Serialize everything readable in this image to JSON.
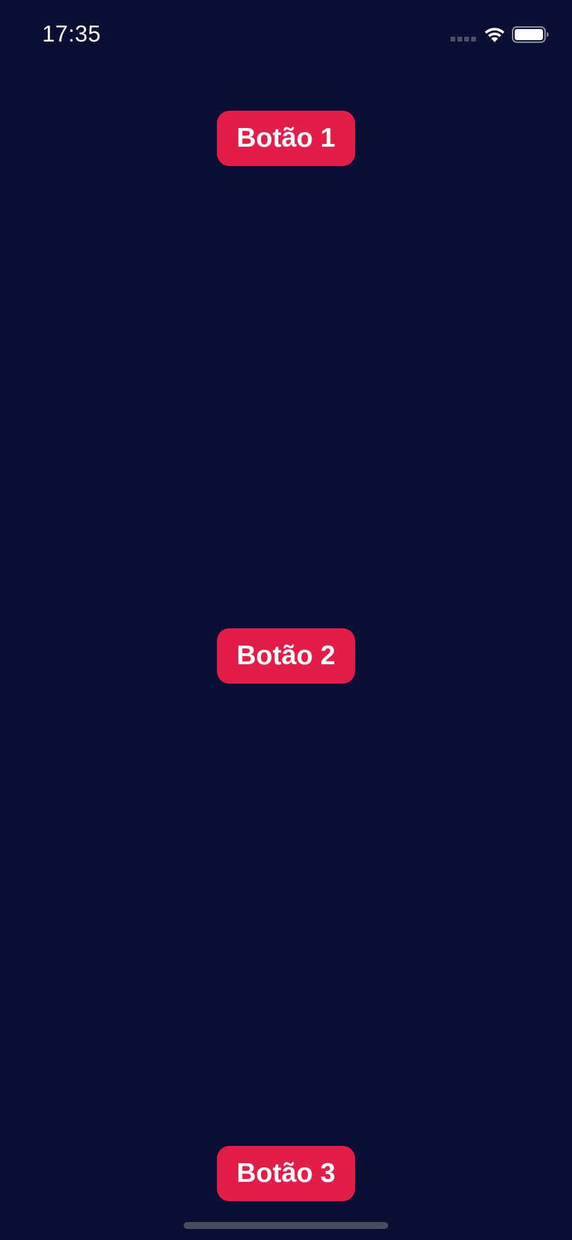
{
  "status_bar": {
    "time": "17:35",
    "icons": [
      "cellular-signal-icon",
      "wifi-icon",
      "battery-icon"
    ]
  },
  "buttons": [
    {
      "label": "Botão 1"
    },
    {
      "label": "Botão 2"
    },
    {
      "label": "Botão 3"
    }
  ],
  "colors": {
    "background": "#0a0f33",
    "button": "#e31c48",
    "button_text": "#ffffff",
    "home_indicator": "#4a4d5e"
  }
}
